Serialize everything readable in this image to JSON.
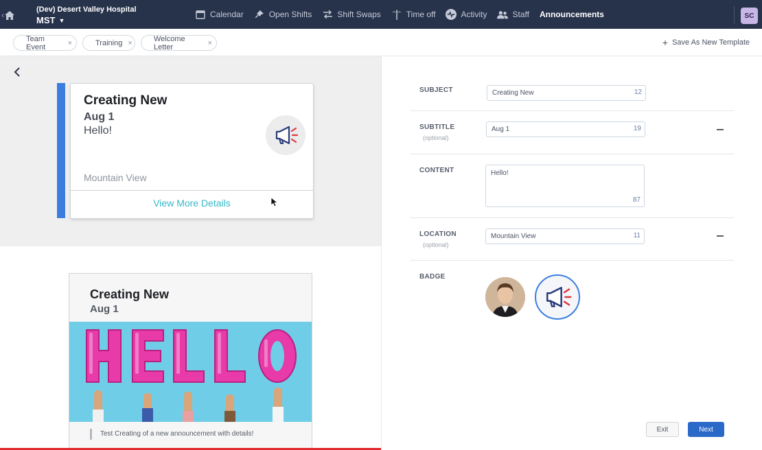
{
  "nav": {
    "org_name": "(Dev) Desert Valley Hospital",
    "timezone": "MST",
    "links": [
      {
        "label": "Calendar",
        "icon": "calendar-icon"
      },
      {
        "label": "Open Shifts",
        "icon": "pin-icon"
      },
      {
        "label": "Shift Swaps",
        "icon": "swap-icon"
      },
      {
        "label": "Time off",
        "icon": "palm-tree-icon"
      },
      {
        "label": "Activity",
        "icon": "pulse-icon"
      },
      {
        "label": "Staff",
        "icon": "people-icon"
      },
      {
        "label": "Announcements",
        "icon": "none",
        "active": true
      }
    ],
    "user_initials": "SC",
    "colors": {
      "bar": "#27324b",
      "avatar": "#c8b7e6"
    }
  },
  "templates": {
    "chips": [
      "Team Event",
      "Training",
      "Welcome Letter"
    ],
    "save_label": "Save As New Template"
  },
  "preview": {
    "title": "Creating New",
    "subtitle": "Aug 1",
    "content": "Hello!",
    "location": "Mountain View",
    "more_label": "View More Details",
    "accent_color": "#3c7ee0"
  },
  "detail": {
    "title": "Creating New",
    "subtitle": "Aug 1",
    "image_text": "HELLO",
    "quote": "Test Creating of a new announcement with details!"
  },
  "form": {
    "subject": {
      "label": "SUBJECT",
      "value": "Creating New",
      "count": "12"
    },
    "subtitle": {
      "label": "SUBTITLE",
      "hint": "(optional)",
      "value": "Aug 1",
      "count": "19"
    },
    "content": {
      "label": "CONTENT",
      "value": "Hello!",
      "count": "87"
    },
    "location": {
      "label": "LOCATION",
      "hint": "(optional)",
      "value": "Mountain View",
      "count": "11"
    },
    "badge": {
      "label": "BADGE"
    }
  },
  "actions": {
    "exit": "Exit",
    "next": "Next"
  }
}
